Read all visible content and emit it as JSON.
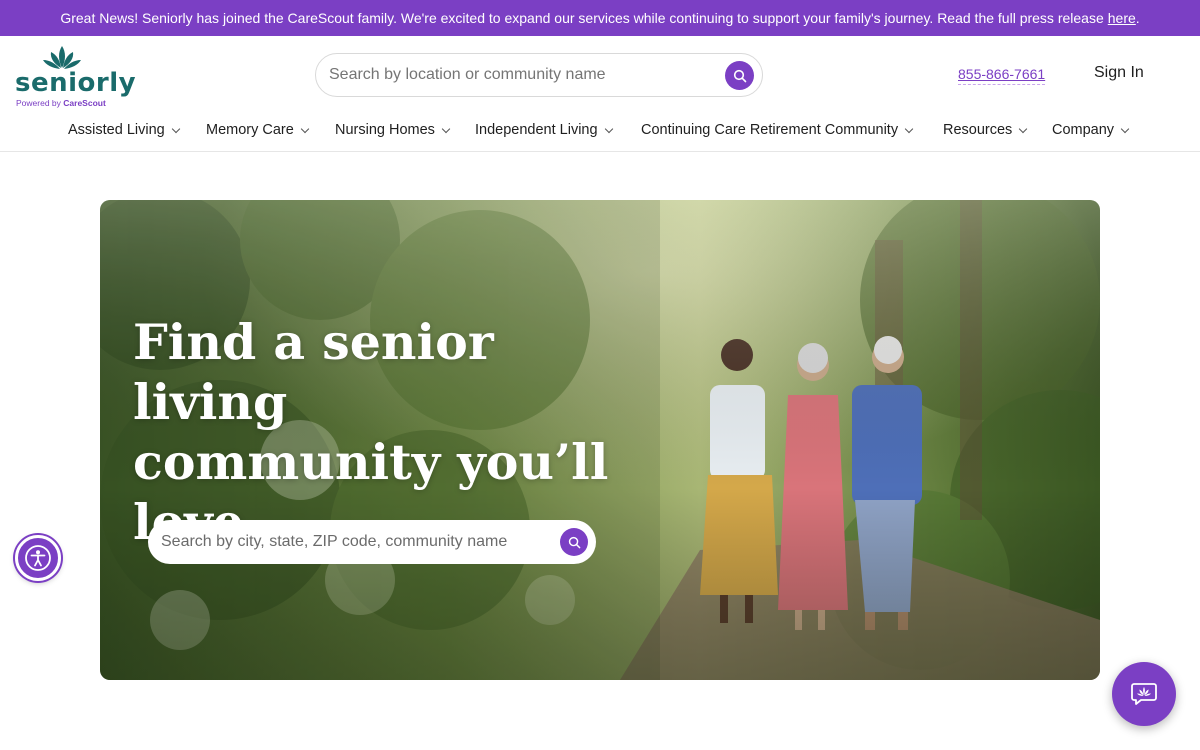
{
  "banner": {
    "text": "Great News! Seniorly has joined the CareScout family. We're excited to expand our services while continuing to support your family's journey. Read the full press release",
    "link_label": "here",
    "trailing": "."
  },
  "logo": {
    "wordmark": "seniorly",
    "powered_prefix": "Powered by",
    "powered_brand": "CareScout"
  },
  "header": {
    "search_placeholder": "Search by location or community name",
    "phone": "855-866-7661",
    "sign_in": "Sign In"
  },
  "nav": {
    "items": [
      {
        "label": "Assisted Living"
      },
      {
        "label": "Memory Care"
      },
      {
        "label": "Nursing Homes"
      },
      {
        "label": "Independent Living"
      },
      {
        "label": "Continuing Care Retirement Community"
      },
      {
        "label": "Resources"
      },
      {
        "label": "Company"
      }
    ]
  },
  "hero": {
    "title_line1": "Find a senior living",
    "title_line2": "community you’ll",
    "title_line3": "love",
    "search_placeholder": "Search by city, state, ZIP code, community name"
  },
  "icons": {
    "search": "search-icon",
    "chevron": "chevron-down-icon",
    "accessibility": "accessibility-icon",
    "chat": "chat-icon",
    "logo": "seniorly-flower-icon"
  },
  "colors": {
    "brand_purple": "#7b3fc4",
    "brand_teal": "#1a6b6b",
    "text": "#1f1f1f"
  }
}
